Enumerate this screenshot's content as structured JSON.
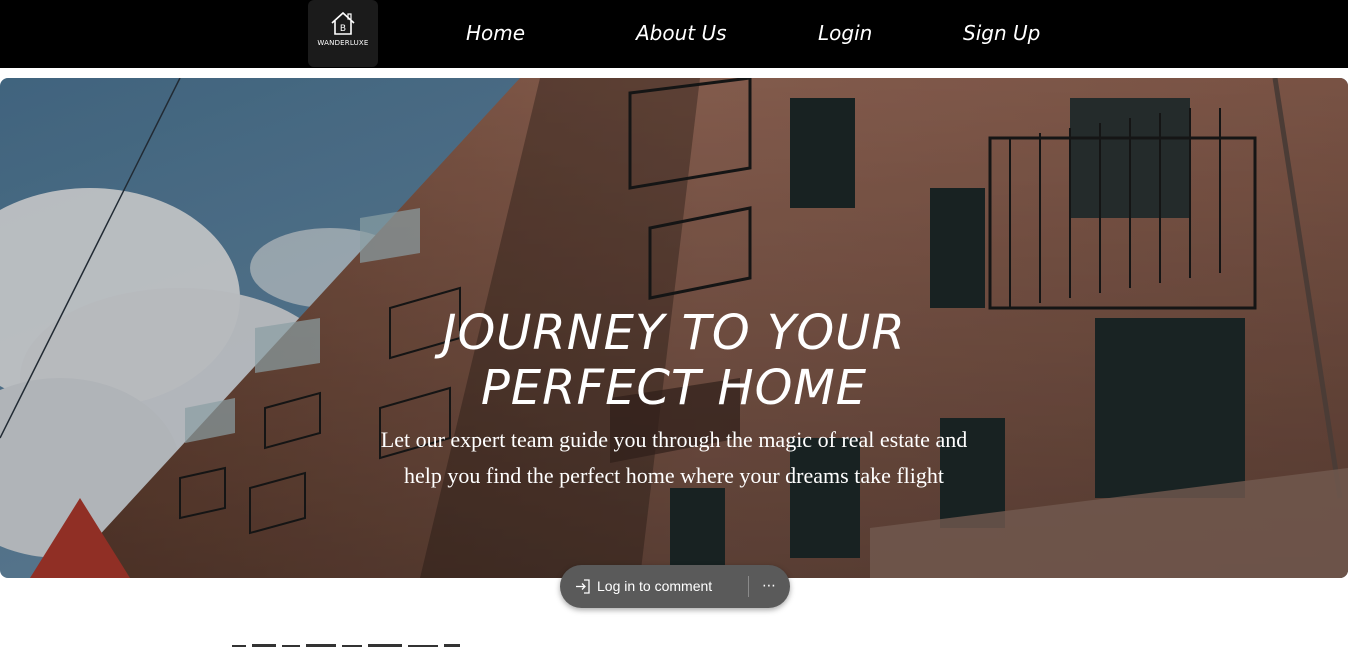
{
  "brand": {
    "name": "WANDERLUXE",
    "logo_icon": "house-logo-icon"
  },
  "nav": {
    "items": [
      {
        "label": "Home"
      },
      {
        "label": "About Us"
      },
      {
        "label": "Login"
      },
      {
        "label": "Sign Up"
      }
    ]
  },
  "hero": {
    "title_line1": "JOURNEY TO YOUR",
    "title_line2": "PERFECT HOME",
    "subtitle_line1": "Let our expert team guide you through the magic of real estate and",
    "subtitle_line2": "help you find the perfect home where your dreams take flight",
    "image": "apartment-building-photo"
  },
  "comment_bar": {
    "label": "Log in to comment",
    "login_icon": "login-arrow-icon",
    "more_icon": "more-options-icon"
  },
  "colors": {
    "nav_bg": "#000000",
    "logo_bg": "#1b1b1b",
    "comment_bg": "#5a5a5a",
    "text": "#ffffff"
  }
}
